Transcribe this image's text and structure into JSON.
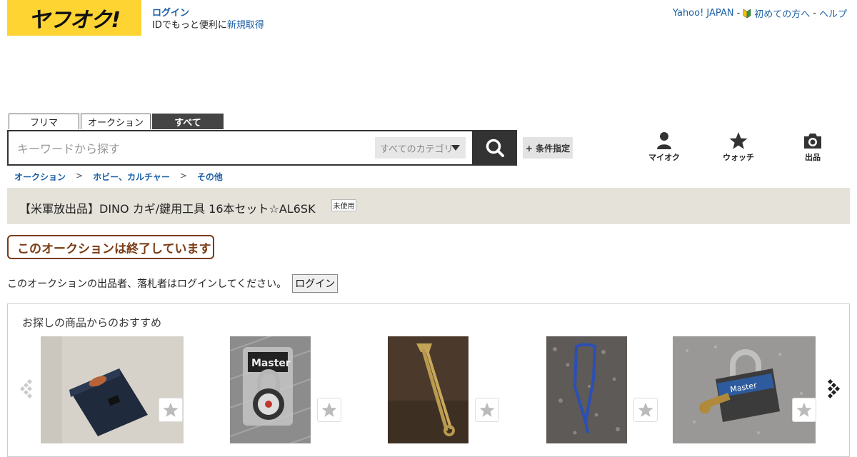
{
  "header": {
    "logo_text": "ヤフオク!",
    "login_link": "ログイン",
    "id_prefix": "IDでもっと便利に",
    "signup_link": "新規取得",
    "links": [
      "Yahoo! JAPAN",
      "初めての方へ",
      "ヘルプ"
    ],
    "separator": "-"
  },
  "search": {
    "tabs": [
      "フリマ",
      "オークション",
      "すべて"
    ],
    "active_tab": "すべて",
    "placeholder": "キーワードから探す",
    "value": "",
    "category": "すべてのカテゴリ",
    "condition_button": "+ 条件指定"
  },
  "quick_icons": [
    {
      "icon": "person-icon",
      "label": "マイオク"
    },
    {
      "icon": "star-icon",
      "label": "ウォッチ"
    },
    {
      "icon": "camera-icon",
      "label": "出品"
    }
  ],
  "breadcrumb": [
    "オークション",
    "ホビー、カルチャー",
    "その他"
  ],
  "breadcrumb_sep": ">",
  "item": {
    "title": "【米軍放出品】DINO カギ/鍵用工具 16本セット☆AL6SK",
    "condition": "未使用"
  },
  "status": {
    "ended_text": "このオークションは終了しています",
    "login_prompt": "このオークションの出品者、落札者はログインしてください。",
    "login_button": "ログイン"
  },
  "recommend": {
    "title": "お探しの商品からのおすすめ",
    "items": [
      {
        "name": "navy-wallet-pouch",
        "colors": [
          "#c9c4bb",
          "#1f2a3c"
        ]
      },
      {
        "name": "master-combination-lock",
        "colors": [
          "#8a8a8a",
          "#2a2a2a"
        ]
      },
      {
        "name": "brass-safety-pin",
        "colors": [
          "#4b3a2c",
          "#b99a4f"
        ]
      },
      {
        "name": "blue-lanyard",
        "colors": [
          "#5d5a57",
          "#2b4fb5"
        ]
      },
      {
        "name": "padlock-with-keys",
        "colors": [
          "#9a9896",
          "#2d5b9e"
        ]
      }
    ]
  }
}
